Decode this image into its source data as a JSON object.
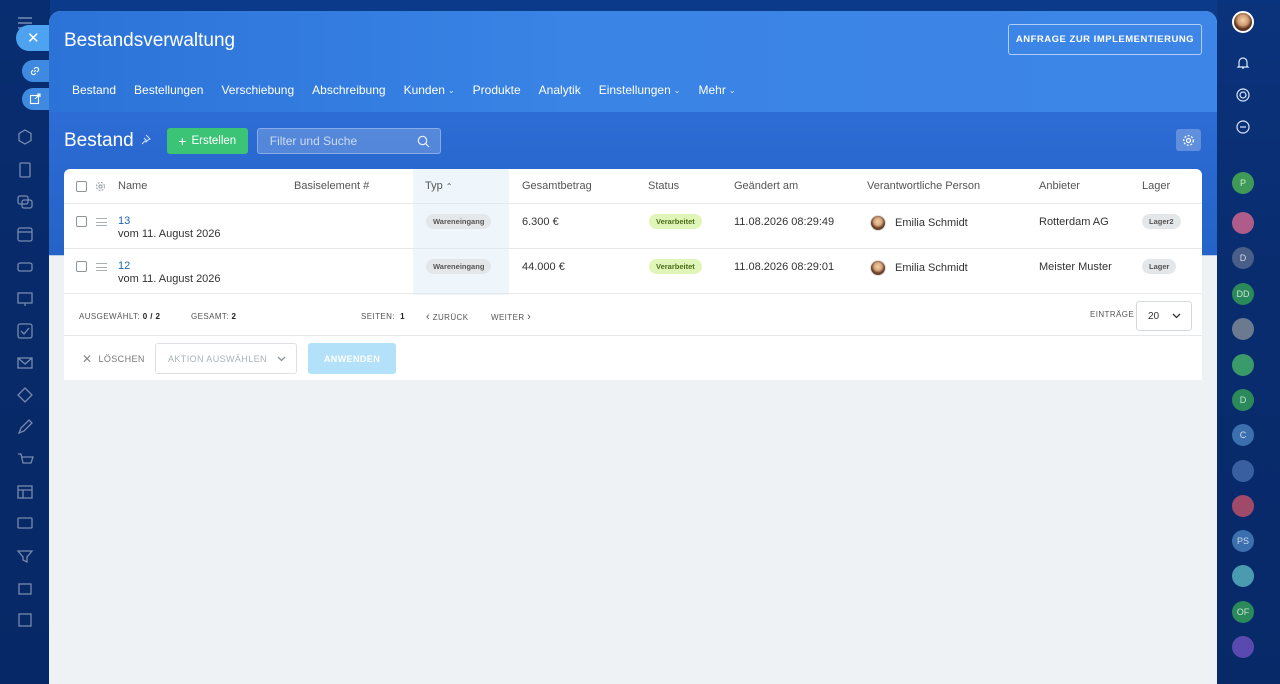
{
  "header": {
    "title": "Bestandsverwaltung",
    "request_button": "ANFRAGE ZUR IMPLEMENTIERUNG"
  },
  "nav": {
    "items": [
      "Bestand",
      "Bestellungen",
      "Verschiebung",
      "Abschreibung",
      "Kunden",
      "Produkte",
      "Analytik",
      "Einstellungen",
      "Mehr"
    ]
  },
  "toolbar": {
    "title": "Bestand",
    "create_label": "Erstellen",
    "search_placeholder": "Filter und Suche"
  },
  "table": {
    "columns": [
      "Name",
      "Basiselement #",
      "Typ",
      "Gesamtbetrag",
      "Status",
      "Geändert am",
      "Verantwortliche Person",
      "Anbieter",
      "Lager"
    ],
    "sort_column": "Typ",
    "rows": [
      {
        "number": "13",
        "date": "vom 11. August 2026",
        "type": "Wareneingang",
        "total": "6.300 €",
        "status": "Verarbeitet",
        "changed": "11.08.2026 08:29:49",
        "person": "Emilia Schmidt",
        "supplier": "Rotterdam AG",
        "warehouse": "Lager2"
      },
      {
        "number": "12",
        "date": "vom 11. August 2026",
        "type": "Wareneingang",
        "total": "44.000 €",
        "status": "Verarbeitet",
        "changed": "11.08.2026 08:29:01",
        "person": "Emilia Schmidt",
        "supplier": "Meister Muster",
        "warehouse": "Lager"
      }
    ]
  },
  "footer": {
    "selected_label": "AUSGEWÄHLT:",
    "selected_value": "0 / 2",
    "total_label": "GESAMT:",
    "total_value": "2",
    "pages_label": "SEITEN:",
    "pages_value": "1",
    "prev_label": "ZURÜCK",
    "next_label": "WEITER",
    "entries_label": "EINTRÄGE",
    "entries_value": "20"
  },
  "actions": {
    "delete_label": "LÖSCHEN",
    "action_placeholder": "AKTION AUSWÄHLEN",
    "apply_label": "ANWENDEN"
  },
  "right_rail": {
    "items": [
      "P",
      "D",
      "DD",
      "D",
      "C",
      "PS",
      "OF"
    ]
  },
  "colors": {
    "accent": "#3bc475",
    "header_blue": "#3a84e6",
    "link": "#2066b0",
    "status_green": "#e0f5b8"
  }
}
